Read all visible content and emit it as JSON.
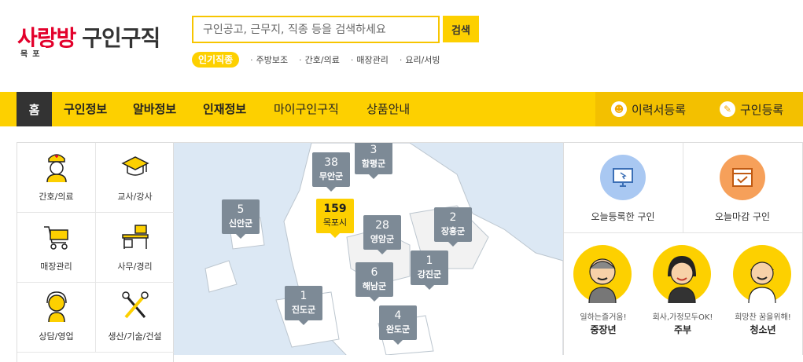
{
  "logo": {
    "brand_a": "사랑방",
    "region": "목포",
    "sub": "구인구직"
  },
  "search": {
    "placeholder": "구인공고, 근무지, 직종 등을 검색하세요",
    "button": "검색"
  },
  "popular": {
    "tag": "인기직종",
    "keywords": [
      "주방보조",
      "간호/의료",
      "매장관리",
      "요리/서빙"
    ]
  },
  "nav": {
    "home": "홈",
    "items": [
      "구인정보",
      "알바정보",
      "인재정보",
      "마이구인구직",
      "상품안내"
    ],
    "resume": "이력서등록",
    "job_post": "구인등록"
  },
  "categories": [
    "간호/의료",
    "교사/강사",
    "매장관리",
    "사무/경리",
    "상담/영업",
    "생산/기술/건설"
  ],
  "map": {
    "markers": [
      {
        "num": "3",
        "name": "함평군"
      },
      {
        "num": "38",
        "name": "무안군"
      },
      {
        "num": "5",
        "name": "신안군"
      },
      {
        "num": "159",
        "name": "목포시"
      },
      {
        "num": "28",
        "name": "영암군"
      },
      {
        "num": "2",
        "name": "장흥군"
      },
      {
        "num": "1",
        "name": "강진군"
      },
      {
        "num": "6",
        "name": "해남군"
      },
      {
        "num": "1",
        "name": "진도군"
      },
      {
        "num": "4",
        "name": "완도군"
      }
    ]
  },
  "today": {
    "registered": "오늘등록한 구인",
    "closing": "오늘마감 구인"
  },
  "personas": [
    {
      "caption": "일하는즐거움!",
      "type": "중장년"
    },
    {
      "caption": "회사,가정모두OK!",
      "type": "주부"
    },
    {
      "caption": "희망찬 꿈을위해!",
      "type": "청소년"
    }
  ],
  "colors": {
    "accent": "#fdd000",
    "nav_dark": "#333333",
    "marker": "#7d8a96",
    "brand_red": "#e3002b"
  }
}
